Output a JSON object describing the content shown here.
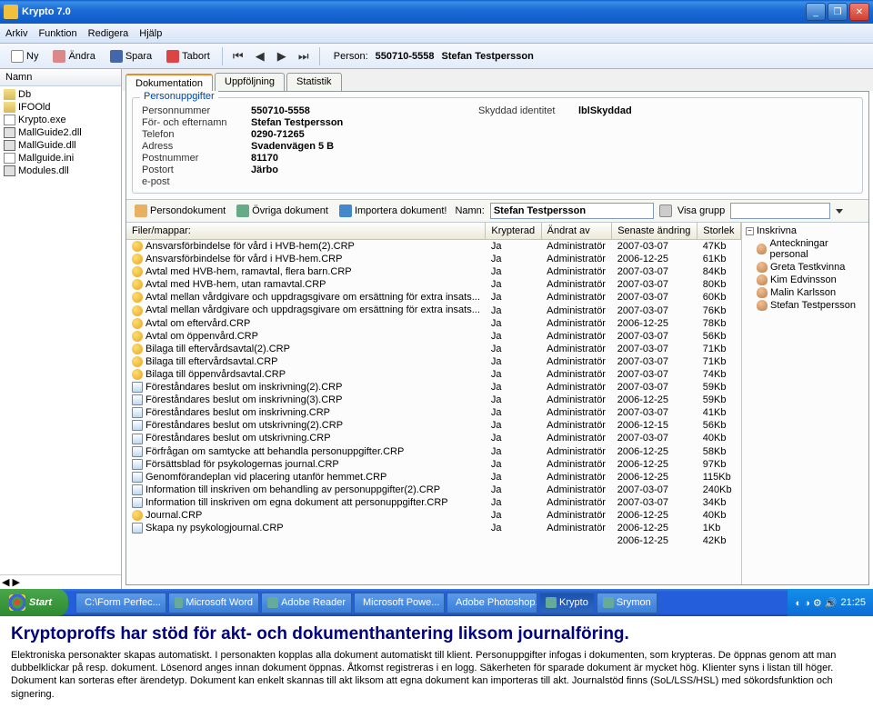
{
  "window": {
    "title": "Krypto 7.0"
  },
  "menu": {
    "arkiv": "Arkiv",
    "funktion": "Funktion",
    "redigera": "Redigera",
    "hjalp": "Hjälp"
  },
  "toolbar": {
    "ny": "Ny",
    "andra": "Ändra",
    "spara": "Spara",
    "tabort": "Tabort",
    "person_lbl": "Person:",
    "person_nr": "550710-5558",
    "person_name": "Stefan Testpersson"
  },
  "sidebar_left": {
    "header": "Namn",
    "items": [
      {
        "label": "Db",
        "type": "folder"
      },
      {
        "label": "IFOOld",
        "type": "folder"
      },
      {
        "label": "Krypto.exe",
        "type": "file"
      },
      {
        "label": "MallGuide2.dll",
        "type": "dll"
      },
      {
        "label": "MallGuide.dll",
        "type": "dll"
      },
      {
        "label": "Mallguide.ini",
        "type": "file"
      },
      {
        "label": "Modules.dll",
        "type": "dll"
      }
    ]
  },
  "tabs": {
    "dokumentation": "Dokumentation",
    "uppfoljning": "Uppföljning",
    "statistik": "Statistik"
  },
  "personuppgifter": {
    "title": "Personuppgifter",
    "labels": {
      "personnummer": "Personnummer",
      "namn": "För- och efternamn",
      "telefon": "Telefon",
      "adress": "Adress",
      "postnummer": "Postnummer",
      "postort": "Postort",
      "epost": "e-post",
      "skyddad": "Skyddad identitet"
    },
    "values": {
      "personnummer": "550710-5558",
      "namn": "Stefan Testpersson",
      "telefon": "0290-71265",
      "adress": "Svadenvägen 5 B",
      "postnummer": "81170",
      "postort": "Järbo",
      "epost": "",
      "skyddad": "lblSkyddad"
    }
  },
  "docbar": {
    "persondokument": "Persondokument",
    "ovriga": "Övriga dokument",
    "importera": "Importera dokument!",
    "namn_lbl": "Namn:",
    "namn_val": "Stefan Testpersson",
    "visa_grupp": "Visa grupp"
  },
  "columns": {
    "filer": "Filer/mappar:",
    "krypterad": "Krypterad",
    "andrat": "Ändrat av",
    "senaste": "Senaste ändring",
    "storlek": "Storlek"
  },
  "documents": [
    {
      "name": "Ansvarsförbindelse för vård i HVB-hem(2).CRP",
      "kryp": "Ja",
      "av": "Administratör",
      "date": "2007-03-07",
      "size": "47Kb",
      "ico": "crp"
    },
    {
      "name": "Ansvarsförbindelse för vård i HVB-hem.CRP",
      "kryp": "Ja",
      "av": "Administratör",
      "date": "2006-12-25",
      "size": "61Kb",
      "ico": "crp"
    },
    {
      "name": "Avtal med HVB-hem, ramavtal, flera barn.CRP",
      "kryp": "Ja",
      "av": "Administratör",
      "date": "2007-03-07",
      "size": "84Kb",
      "ico": "crp"
    },
    {
      "name": "Avtal med HVB-hem, utan ramavtal.CRP",
      "kryp": "Ja",
      "av": "Administratör",
      "date": "2007-03-07",
      "size": "80Kb",
      "ico": "crp"
    },
    {
      "name": "Avtal mellan vårdgivare och uppdragsgivare om ersättning för extra insats...",
      "kryp": "Ja",
      "av": "Administratör",
      "date": "2007-03-07",
      "size": "60Kb",
      "ico": "crp"
    },
    {
      "name": "Avtal mellan vårdgivare och uppdragsgivare om ersättning för extra insats...",
      "kryp": "Ja",
      "av": "Administratör",
      "date": "2007-03-07",
      "size": "76Kb",
      "ico": "crp"
    },
    {
      "name": "Avtal om eftervård.CRP",
      "kryp": "Ja",
      "av": "Administratör",
      "date": "2006-12-25",
      "size": "78Kb",
      "ico": "crp"
    },
    {
      "name": "Avtal om öppenvård.CRP",
      "kryp": "Ja",
      "av": "Administratör",
      "date": "2007-03-07",
      "size": "56Kb",
      "ico": "crp"
    },
    {
      "name": "Bilaga till eftervårdsavtal(2).CRP",
      "kryp": "Ja",
      "av": "Administratör",
      "date": "2007-03-07",
      "size": "71Kb",
      "ico": "crp"
    },
    {
      "name": "Bilaga till eftervårdsavtal.CRP",
      "kryp": "Ja",
      "av": "Administratör",
      "date": "2007-03-07",
      "size": "71Kb",
      "ico": "crp"
    },
    {
      "name": "Bilaga till öppenvårdsavtal.CRP",
      "kryp": "Ja",
      "av": "Administratör",
      "date": "2007-03-07",
      "size": "74Kb",
      "ico": "crp"
    },
    {
      "name": "Föreståndares beslut om inskrivning(2).CRP",
      "kryp": "Ja",
      "av": "Administratör",
      "date": "2007-03-07",
      "size": "59Kb",
      "ico": "other"
    },
    {
      "name": "Föreståndares beslut om inskrivning(3).CRP",
      "kryp": "Ja",
      "av": "Administratör",
      "date": "2006-12-25",
      "size": "59Kb",
      "ico": "other"
    },
    {
      "name": "Föreståndares beslut om inskrivning.CRP",
      "kryp": "Ja",
      "av": "Administratör",
      "date": "2007-03-07",
      "size": "41Kb",
      "ico": "other"
    },
    {
      "name": "Föreståndares beslut om utskrivning(2).CRP",
      "kryp": "Ja",
      "av": "Administratör",
      "date": "2006-12-15",
      "size": "56Kb",
      "ico": "other"
    },
    {
      "name": "Föreståndares beslut om utskrivning.CRP",
      "kryp": "Ja",
      "av": "Administratör",
      "date": "2007-03-07",
      "size": "40Kb",
      "ico": "other"
    },
    {
      "name": "Förfrågan om samtycke att behandla personuppgifter.CRP",
      "kryp": "Ja",
      "av": "Administratör",
      "date": "2006-12-25",
      "size": "58Kb",
      "ico": "other"
    },
    {
      "name": "Försättsblad för psykologernas journal.CRP",
      "kryp": "Ja",
      "av": "Administratör",
      "date": "2006-12-25",
      "size": "97Kb",
      "ico": "other"
    },
    {
      "name": "Genomförandeplan vid placering utanför hemmet.CRP",
      "kryp": "Ja",
      "av": "Administratör",
      "date": "2006-12-25",
      "size": "115Kb",
      "ico": "other"
    },
    {
      "name": "Information till inskriven om behandling av personuppgifter(2).CRP",
      "kryp": "Ja",
      "av": "Administratör",
      "date": "2007-03-07",
      "size": "240Kb",
      "ico": "other"
    },
    {
      "name": "Information till inskriven om egna dokument att personuppgifter.CRP",
      "kryp": "Ja",
      "av": "Administratör",
      "date": "2007-03-07",
      "size": "34Kb",
      "ico": "other"
    },
    {
      "name": "Journal.CRP",
      "kryp": "Ja",
      "av": "Administratör",
      "date": "2006-12-25",
      "size": "40Kb",
      "ico": "crp"
    },
    {
      "name": "Skapa ny psykologjournal.CRP",
      "kryp": "Ja",
      "av": "Administratör",
      "date": "2006-12-25",
      "size": "1Kb",
      "ico": "other"
    },
    {
      "name": "",
      "kryp": "",
      "av": "",
      "date": "2006-12-25",
      "size": "42Kb",
      "ico": ""
    }
  ],
  "sidebar_right": {
    "group": "Inskrivna",
    "items": [
      "Anteckningar personal",
      "Greta Testkvinna",
      "Kim Edvinsson",
      "Malin Karlsson",
      "Stefan Testpersson"
    ]
  },
  "taskbar": {
    "start": "Start",
    "tasks": [
      "C:\\Form Perfec...",
      "Microsoft Word",
      "Adobe Reader",
      "Microsoft Powe...",
      "Adobe Photoshop...",
      "Krypto",
      "Srymon"
    ],
    "time": "21:25"
  },
  "description": {
    "heading": "Kryptoproffs har stöd för akt- och dokumenthantering liksom journalföring.",
    "body": "Elektroniska personakter skapas automatiskt. I personakten kopplas alla dokument automatiskt till klient. Personuppgifter infogas i dokumenten, som krypteras. De öppnas genom att man dubbelklickar på resp. dokument. Lösenord anges innan dokument öppnas. Åtkomst registreras i en logg. Säkerheten för sparade dokument är mycket hög. Klienter syns i listan till höger. Dokument kan sorteras efter ärendetyp. Dokument kan enkelt skannas till akt liksom att egna dokument kan importeras till akt. Journalstöd finns (SoL/LSS/HSL) med sökordsfunktion och signering."
  }
}
